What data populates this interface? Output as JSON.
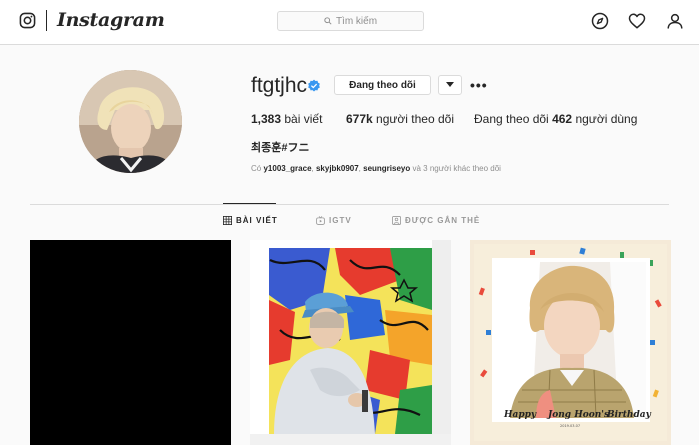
{
  "header": {
    "logo_text": "Instagram",
    "search_placeholder": "Tìm kiếm",
    "icons": [
      "instagram-glyph-icon",
      "search-icon",
      "compass-icon",
      "heart-icon",
      "user-icon"
    ]
  },
  "profile": {
    "username": "ftgtjhc",
    "verified": true,
    "follow_button": "Đang theo dõi",
    "posts_count": "1,383",
    "posts_label": "bài viết",
    "followers_count": "677k",
    "followers_label": "người theo dõi",
    "following_prefix": "Đang theo dõi",
    "following_count": "462",
    "following_label": "người dùng",
    "full_name": "최종훈#フニ",
    "followed_by_prefix": "Có",
    "followed_by_users": [
      "y1003_grace",
      "skyjbk0907",
      "seungriseyo"
    ],
    "followed_by_suffix": "và 3 người khác theo dõi"
  },
  "tabs": [
    {
      "label": "BÀI VIẾT",
      "active": true,
      "icon": "grid-icon"
    },
    {
      "label": "IGTV",
      "active": false,
      "icon": "igtv-icon"
    },
    {
      "label": "ĐƯỢC GẮN THẺ",
      "active": false,
      "icon": "tag-icon"
    }
  ],
  "posts": [
    {
      "kind": "black-video"
    },
    {
      "kind": "photo-colorful-painting"
    },
    {
      "kind": "photo-birthday-card",
      "caption_words": [
        "Happy",
        "Jong Hoon's",
        "Birthday"
      ],
      "date_text": "2019.03.07"
    }
  ],
  "colors": {
    "accent": "#3897f0",
    "text": "#262626",
    "muted": "#8e8e8e",
    "border": "#dbdbdb",
    "background": "#fafafa"
  }
}
